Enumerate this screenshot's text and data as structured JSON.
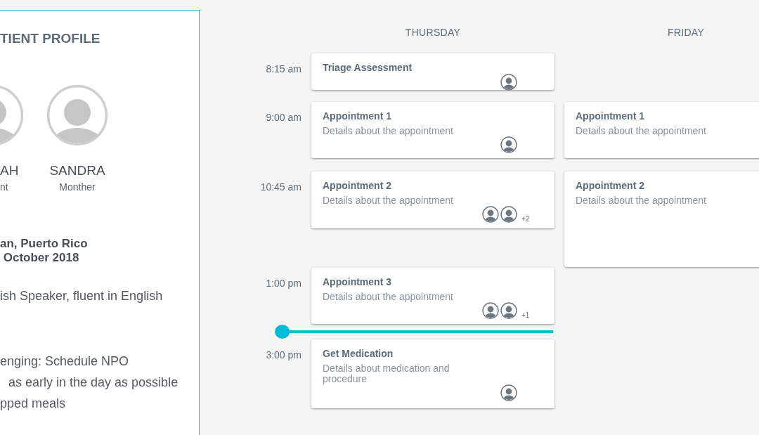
{
  "profile": {
    "title": "TIENT PROFILE",
    "family": [
      {
        "name": "AH",
        "role": "nt",
        "kind": "cut"
      },
      {
        "name": "SANDRA",
        "role": "Monther",
        "kind": "full"
      }
    ],
    "address": [
      "an, Puerto Rico",
      " October 2018"
    ],
    "language": "ish Speaker, fluent in English",
    "notes": [
      "enging: Schedule NPO",
      "as early in the day as possible",
      "pped meals"
    ]
  },
  "schedule": {
    "times": [
      "8:15 am",
      "9:00 am",
      "10:45 am",
      "1:00 pm",
      "3:00 pm"
    ],
    "days": [
      {
        "name": "THURSDAY",
        "events": [
          {
            "title": "Triage Assessment",
            "avatars": [
              {
                "kind": "person"
              }
            ]
          },
          {
            "title": "Appointment 1",
            "details": "Details about the appointment",
            "avatars": [
              {
                "kind": "person"
              }
            ]
          },
          {
            "title": "Appointment 2",
            "details": "Details about the appointment",
            "avatars": [
              {
                "kind": "person"
              },
              {
                "kind": "person"
              }
            ],
            "more": "+2"
          },
          {
            "title": "Appointment 3",
            "details": "Details about the appointment",
            "avatars": [
              {
                "kind": "person"
              },
              {
                "kind": "person"
              }
            ],
            "more": "+1"
          },
          {
            "title": "Get Medication",
            "details": "Details about medication and procedure",
            "avatars": [
              {
                "kind": "person"
              }
            ]
          }
        ]
      },
      {
        "name": "FRIDAY",
        "events": [
          {
            "title": "Appointment 1",
            "details": "Details about the appointment"
          },
          {
            "title": "Appointment 2",
            "details": "Details about the appointment"
          }
        ]
      }
    ]
  }
}
